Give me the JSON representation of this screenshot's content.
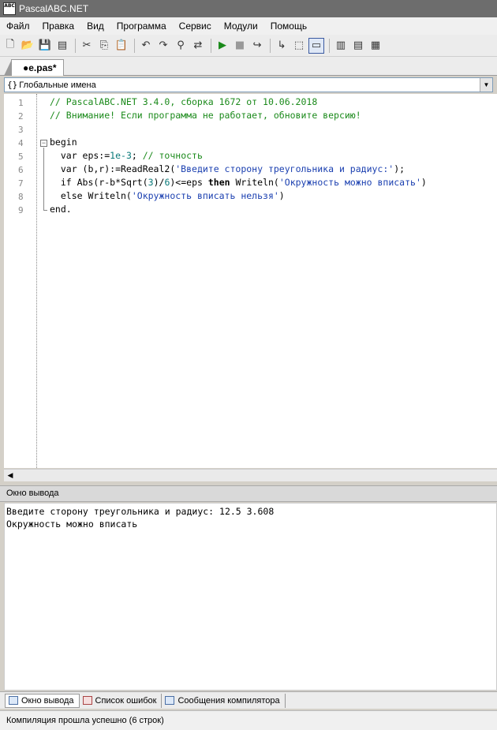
{
  "window": {
    "title": "PascalABC.NET",
    "icon_text": "ABC"
  },
  "menu": [
    "Файл",
    "Правка",
    "Вид",
    "Программа",
    "Сервис",
    "Модули",
    "Помощь"
  ],
  "toolbar": {
    "icons": [
      "new-file-icon",
      "open-folder-icon",
      "save-icon",
      "save-all-icon",
      "cut-icon",
      "copy-icon",
      "paste-icon",
      "undo-icon",
      "redo-icon",
      "find-icon",
      "replace-icon",
      "run-icon",
      "stop-icon",
      "step-over-icon",
      "step-into-icon",
      "output-window-icon",
      "debug-icon",
      "format-icon",
      "compile-icon",
      "intellisense-icon"
    ],
    "glyphs": [
      "🗋",
      "📂",
      "💾",
      "▤",
      "✂",
      "⎘",
      "📋",
      "↶",
      "↷",
      "⚲",
      "⇄",
      "▶",
      "■",
      "↪",
      "↳",
      "▭",
      "⬚",
      "▥",
      "▤",
      "▦"
    ]
  },
  "tab": {
    "label": "●e.pas*"
  },
  "scope": {
    "icon": "{}",
    "label": "Глобальные имена"
  },
  "editor": {
    "line_numbers": [
      "1",
      "2",
      "3",
      "4",
      "5",
      "6",
      "7",
      "8",
      "9"
    ],
    "lines": {
      "l1": "// PascalABC.NET 3.4.0, сборка 1672 от 10.06.2018",
      "l2": "// Внимание! Если программа не работает, обновите версию!",
      "l4": "begin",
      "l5a": "  var eps:=",
      "l5b": "1e-3",
      "l5c": "; ",
      "l5d": "// точность",
      "l6a": "  var (b,r):=ReadReal2(",
      "l6b": "'Введите сторону треугольника и радиус:'",
      "l6c": ");",
      "l7a": "  if",
      "l7b": " Abs(r-b*Sqrt(",
      "l7c": "3",
      "l7d": ")/",
      "l7e": "6",
      "l7f": ")<=eps ",
      "l7g": "then",
      "l7h": " Writeln(",
      "l7i": "'Окружность можно вписать'",
      "l7j": ")",
      "l8a": "  else",
      "l8b": " Writeln(",
      "l8c": "'Окружность вписать нельзя'",
      "l8d": ")",
      "l9": "end."
    }
  },
  "output_panel": {
    "title": "Окно вывода",
    "lines": [
      "Введите сторону треугольника и радиус: 12.5 3.608",
      "Окружность можно вписать"
    ]
  },
  "bottom_tabs": [
    "Окно вывода",
    "Список ошибок",
    "Сообщения компилятора"
  ],
  "status": "Компиляция прошла успешно (6 строк)",
  "colors": {
    "comment": "#1b8a1b",
    "string": "#1a3fb0",
    "number": "#0a7a7a"
  }
}
